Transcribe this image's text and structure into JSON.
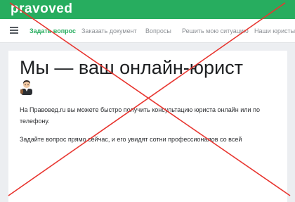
{
  "header": {
    "logo_text": "pravoved",
    "bar_color": "#27ad5f"
  },
  "nav": {
    "menu_icon": "hamburger-menu-icon",
    "items": [
      {
        "label": "Задать вопрос",
        "active": true
      },
      {
        "label": "Заказать документ",
        "active": false
      },
      {
        "label": "Вопросы",
        "active": false
      },
      {
        "label": "Решить мою ситуацию",
        "active": false
      },
      {
        "label": "Наши юристы",
        "active": false
      }
    ]
  },
  "hero": {
    "title": "Мы — ваш онлайн-юрист",
    "emoji_icon": "lawyer-emoji-icon",
    "paragraph_1": "На Правовед.ru вы можете быстро получить консультацию юриста онлайн или по телефону.",
    "paragraph_2": "Задайте вопрос прямо сейчас, и его увидят сотни профессионалов со всей"
  },
  "overlay": {
    "cross_color": "#e8352f"
  }
}
